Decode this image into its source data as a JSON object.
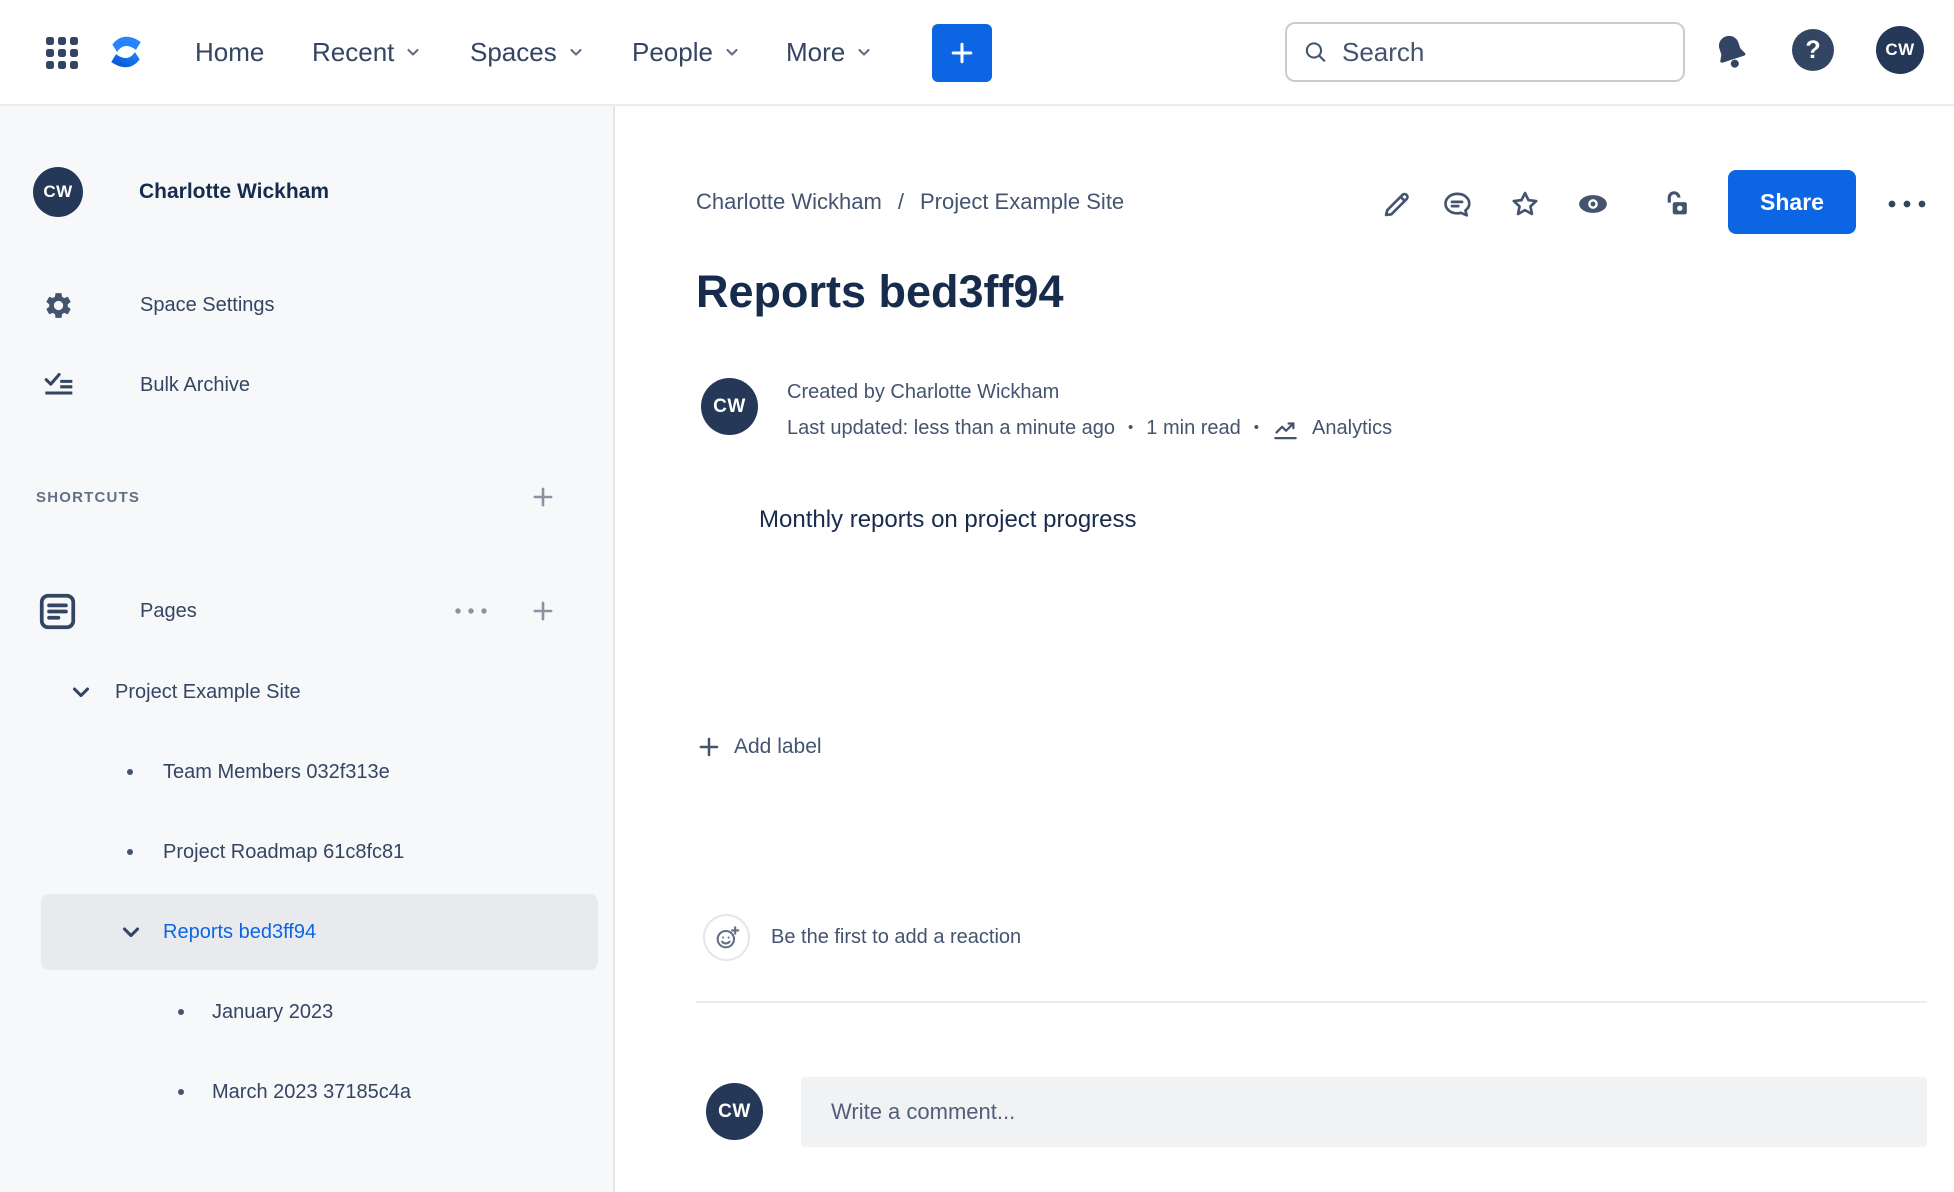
{
  "nav": {
    "home": "Home",
    "recent": "Recent",
    "spaces": "Spaces",
    "people": "People",
    "more": "More",
    "search_placeholder": "Search",
    "help_glyph": "?",
    "avatar_initials": "CW"
  },
  "sidebar": {
    "space_name": "Charlotte Wickham",
    "avatar_initials": "CW",
    "items": [
      {
        "label": "Space Settings"
      },
      {
        "label": "Bulk Archive"
      }
    ],
    "shortcuts_heading": "SHORTCUTS",
    "pages_label": "Pages",
    "tree": {
      "root": "Project Example Site",
      "children": [
        {
          "label": "Team Members 032f313e"
        },
        {
          "label": "Project Roadmap 61c8fc81"
        },
        {
          "label": "Reports bed3ff94"
        },
        {
          "label": "January 2023"
        },
        {
          "label": "March 2023 37185c4a"
        }
      ]
    }
  },
  "page": {
    "breadcrumb": [
      "Charlotte Wickham",
      "Project Example Site"
    ],
    "breadcrumb_separator": "/",
    "title": "Reports bed3ff94",
    "share": "Share",
    "byline": {
      "avatar_initials": "CW",
      "created": "Created by Charlotte Wickham",
      "updated": "Last updated: less than a minute ago",
      "separator": "•",
      "read_time": "1 min read",
      "analytics": "Analytics"
    },
    "body": "Monthly reports on project progress",
    "add_label": "Add label",
    "reaction_prompt": "Be the first to add a reaction",
    "comment": {
      "avatar_initials": "CW",
      "placeholder": "Write a comment..."
    }
  }
}
